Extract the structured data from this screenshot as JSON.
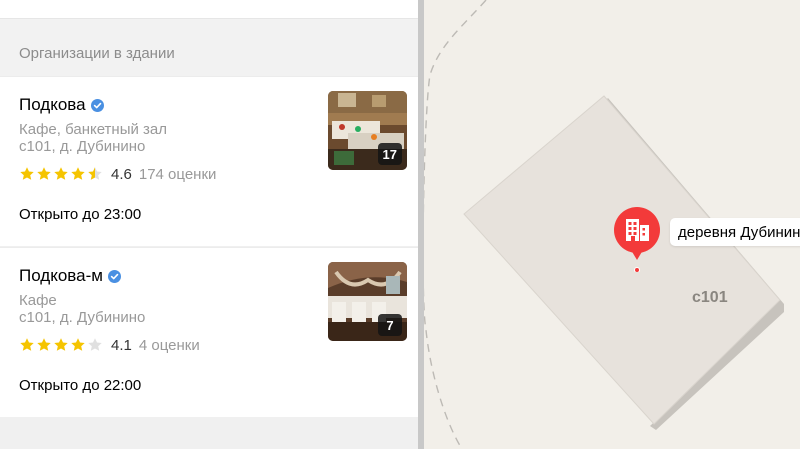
{
  "panel": {
    "section_title": "Организации в здании"
  },
  "organizations": [
    {
      "name": "Подкова",
      "category": "Кафе, банкетный зал",
      "address": "с101, д. Дубинино",
      "rating": 4.6,
      "rating_text": "4.6",
      "stars_filled": 4.5,
      "reviews": "174 оценки",
      "hours": "Открыто до 23:00",
      "photo_count": "17"
    },
    {
      "name": "Подкова-м",
      "category": "Кафе",
      "address": "с101, д. Дубинино",
      "rating": 4.1,
      "rating_text": "4.1",
      "stars_filled": 4,
      "reviews": "4 оценки",
      "hours": "Открыто до 22:00",
      "photo_count": "7"
    }
  ],
  "map": {
    "place_label": "деревня Дубинино",
    "building_label": "с101",
    "pin_icon": "building-icon",
    "pin_color": "#f33a3a"
  },
  "colors": {
    "star": "#f5c400",
    "star_empty": "#e0e0e0",
    "verified": "#3b82f6"
  }
}
